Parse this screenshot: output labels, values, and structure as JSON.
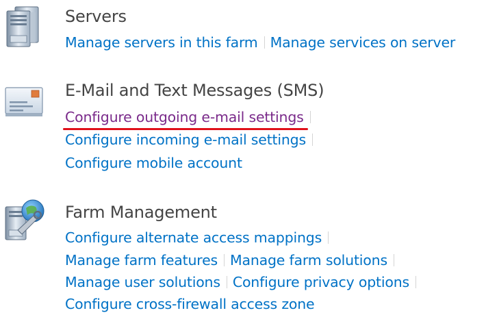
{
  "sections": {
    "servers": {
      "title": "Servers",
      "icon": "servers-icon",
      "links": {
        "manage_servers": "Manage servers in this farm",
        "manage_services": "Manage services on server"
      }
    },
    "email": {
      "title": "E-Mail and Text Messages (SMS)",
      "icon": "email-icon",
      "links": {
        "outgoing": "Configure outgoing e-mail settings",
        "incoming": "Configure incoming e-mail settings",
        "mobile": "Configure mobile account"
      }
    },
    "farm": {
      "title": "Farm Management",
      "icon": "farm-management-icon",
      "links": {
        "alternate_access": "Configure alternate access mappings",
        "farm_features": "Manage farm features",
        "farm_solutions": "Manage farm solutions",
        "user_solutions": "Manage user solutions",
        "privacy": "Configure privacy options",
        "cross_firewall": "Configure cross-firewall access zone"
      }
    }
  },
  "colors": {
    "link": "#0072c6",
    "visited_link": "#7a2a8a",
    "title": "#444444",
    "highlight": "#e0101a"
  }
}
